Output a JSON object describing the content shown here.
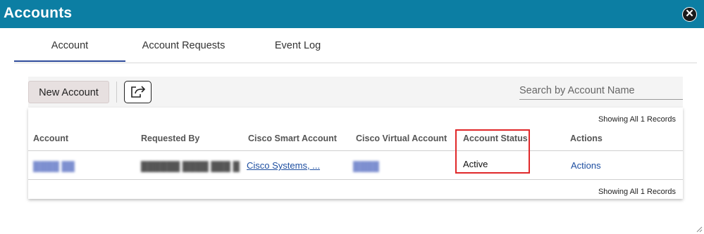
{
  "dialog": {
    "title": "Accounts",
    "close_icon": "close-circle-icon"
  },
  "tabs": [
    {
      "label": "Account",
      "active": true
    },
    {
      "label": "Account Requests",
      "active": false
    },
    {
      "label": "Event Log",
      "active": false
    }
  ],
  "toolbar": {
    "new_account_label": "New Account",
    "export_icon": "export-icon",
    "search_placeholder": "Search by Account Name"
  },
  "grid": {
    "records_top": "Showing All 1 Records",
    "records_bottom": "Showing All 1 Records",
    "columns": [
      "Account",
      "Requested By",
      "Cisco Smart Account",
      "Cisco Virtual Account",
      "Account Status",
      "Actions"
    ],
    "rows": [
      {
        "account": "",
        "requested_by": "",
        "smart_account": "Cisco Systems, ...",
        "virtual_account": "",
        "status": "Active",
        "actions": "Actions"
      }
    ]
  },
  "colors": {
    "titlebar": "#0c7ea3",
    "active_tab": "#2e4a9a",
    "link": "#1d4ea0",
    "highlight": "#e0282a"
  }
}
